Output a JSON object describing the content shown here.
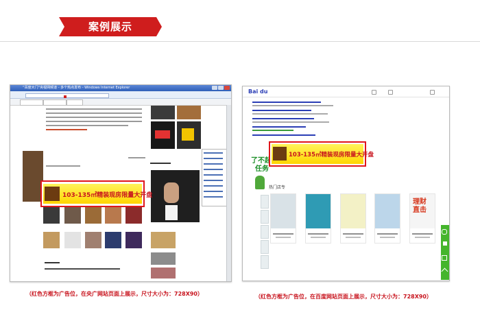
{
  "header": {
    "title": "案例展示",
    "banner_color": "#cf1d1d"
  },
  "left_shot": {
    "browser_title": "“百度大门”央视网频道 - 多个热点发布 - Windows Internet Explorer",
    "ad_text": "103-135㎡精装现房限量大开盘",
    "caption": "（红色方框为广告位，在央广网站页面上展示，尺寸大小为：728X90）"
  },
  "right_shot": {
    "logo_text": "Bai du",
    "ad_text": "103-135㎡精装现房限量大开盘",
    "slogan_line1": "了不起",
    "slogan_line2": "任务",
    "hot_label": "热门店专",
    "card_text_5": "理财直击",
    "caption": "（红色方框为广告位，在百度网站页面上展示，尺寸大小为：728X90）"
  },
  "colors": {
    "ad_frame": "#e0151b",
    "caption": "#c8141e",
    "ad_fill": "#ffe11c"
  }
}
